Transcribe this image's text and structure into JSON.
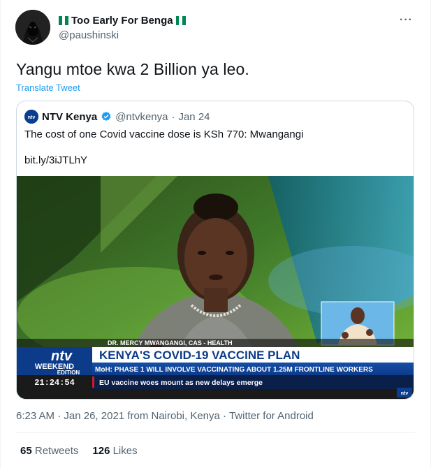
{
  "author": {
    "display_name": "Too Early For Benga",
    "handle": "@paushinski"
  },
  "tweet": {
    "text": "Yangu mtoe kwa 2 Billion ya leo.",
    "translate_label": "Translate Tweet",
    "more_label": "···"
  },
  "quoted": {
    "display_name": "NTV Kenya",
    "handle": "@ntvkenya",
    "separator": "·",
    "date": "Jan 24",
    "text": "The cost of one Covid vaccine dose is KSh 770: Mwangangi",
    "link": "bit.ly/3iJTLhY",
    "avatar_logo": "ntv",
    "media": {
      "caption_name": "DR. MERCY MWANGANGI, CAS - HEALTH",
      "headline": "KENYA'S COVID-19 VACCINE PLAN",
      "subline": "MoH: PHASE 1 WILL INVOLVE VACCINATING ABOUT 1.25M FRONTLINE WORKERS",
      "ticker": "EU vaccine woes mount as new delays emerge",
      "clock": "21:24:54",
      "logo": "ntv",
      "edition_top": "WEEKEND",
      "edition_bottom": "EDITION",
      "corner_logo": "ntv"
    }
  },
  "meta": {
    "time": "6:23 AM",
    "sep1": "·",
    "date": "Jan 26, 2021",
    "location": "from Nairobi, Kenya",
    "sep2": "·",
    "source": "Twitter for Android"
  },
  "stats": {
    "retweets_count": "65",
    "retweets_label": "Retweets",
    "likes_count": "126",
    "likes_label": "Likes"
  },
  "colors": {
    "accent": "#1d9bf0",
    "muted": "#536471",
    "ntv_blue": "#0b3d91",
    "ntv_red": "#d71920"
  }
}
